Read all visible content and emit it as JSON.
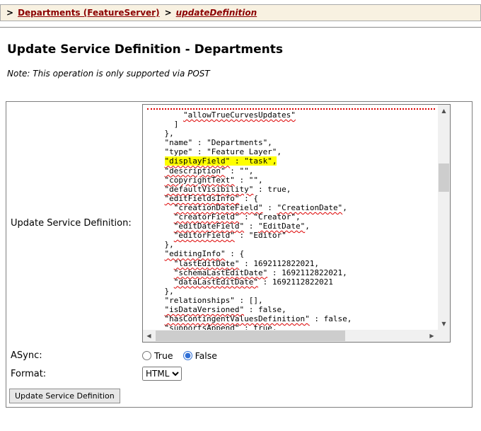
{
  "colors": {
    "breadcrumb_bg": "#f8f1e1",
    "link": "#8b0000",
    "highlight": "#ffff00",
    "spellcheck_underline": "#dd0000"
  },
  "icons": {
    "scroll_up": "▲",
    "scroll_down": "▼",
    "scroll_left": "◀",
    "scroll_right": "▶"
  },
  "breadcrumb": {
    "separator": ">",
    "items": [
      {
        "label": "Departments (FeatureServer)",
        "italic": false
      },
      {
        "label": "updateDefinition",
        "italic": true
      }
    ]
  },
  "page": {
    "title": "Update Service Definition - Departments",
    "note": "Note: This operation is only supported via POST"
  },
  "form": {
    "definition_label": "Update Service Definition:",
    "async_label": "ASync:",
    "async_options": [
      {
        "label": "True",
        "selected": false
      },
      {
        "label": "False",
        "selected": true
      }
    ],
    "format_label": "Format:",
    "format_options": [
      "HTML"
    ],
    "format_value": "HTML",
    "submit_label": "Update Service Definition"
  },
  "editor": {
    "lines": [
      {
        "partial": true,
        "segs": []
      },
      {
        "segs": [
          {
            "t": "        "
          },
          {
            "t": "\"allowTrueCurvesUpdates\"",
            "u": true
          }
        ]
      },
      {
        "segs": [
          {
            "t": "      ]"
          }
        ]
      },
      {
        "segs": [
          {
            "t": "    },"
          }
        ]
      },
      {
        "segs": [
          {
            "t": "    \"name\" : \"Departments\","
          }
        ]
      },
      {
        "segs": [
          {
            "t": "    \"type\" : \"Feature Layer\","
          }
        ]
      },
      {
        "segs": [
          {
            "t": "    "
          },
          {
            "t": "\"displayField\"",
            "u": true,
            "hl": true
          },
          {
            "t": " : \"task\",",
            "hl": true
          }
        ]
      },
      {
        "segs": [
          {
            "t": "    "
          },
          {
            "t": "\"description\"",
            "u": true
          },
          {
            "t": " : \"\","
          }
        ]
      },
      {
        "segs": [
          {
            "t": "    "
          },
          {
            "t": "\"copyrightText\"",
            "u": true
          },
          {
            "t": " : \"\","
          }
        ]
      },
      {
        "segs": [
          {
            "t": "    "
          },
          {
            "t": "\"defaultVisibility\"",
            "u": true
          },
          {
            "t": " : true,"
          }
        ]
      },
      {
        "segs": [
          {
            "t": "    "
          },
          {
            "t": "\"editFieldsInfo\"",
            "u": true
          },
          {
            "t": " : {"
          }
        ]
      },
      {
        "segs": [
          {
            "t": "      "
          },
          {
            "t": "\"creationDateField\"",
            "u": true
          },
          {
            "t": " : "
          },
          {
            "t": "\"CreationDate\"",
            "u": true
          },
          {
            "t": ","
          }
        ]
      },
      {
        "segs": [
          {
            "t": "      "
          },
          {
            "t": "\"creatorField\"",
            "u": true
          },
          {
            "t": " : \"Creator\","
          }
        ]
      },
      {
        "segs": [
          {
            "t": "      "
          },
          {
            "t": "\"editDateField\"",
            "u": true
          },
          {
            "t": " : "
          },
          {
            "t": "\"EditDate\"",
            "u": true
          },
          {
            "t": ","
          }
        ]
      },
      {
        "segs": [
          {
            "t": "      "
          },
          {
            "t": "\"editorField\"",
            "u": true
          },
          {
            "t": " : \"Editor\""
          }
        ]
      },
      {
        "segs": [
          {
            "t": "    },"
          }
        ]
      },
      {
        "segs": [
          {
            "t": "    "
          },
          {
            "t": "\"editingInfo\"",
            "u": true
          },
          {
            "t": " : {"
          }
        ]
      },
      {
        "segs": [
          {
            "t": "      "
          },
          {
            "t": "\"lastEditDate\"",
            "u": true
          },
          {
            "t": " : 1692112822021,"
          }
        ]
      },
      {
        "segs": [
          {
            "t": "      "
          },
          {
            "t": "\"schemaLastEditDate\"",
            "u": true
          },
          {
            "t": " : 1692112822021,"
          }
        ]
      },
      {
        "segs": [
          {
            "t": "      "
          },
          {
            "t": "\"dataLastEditDate\"",
            "u": true
          },
          {
            "t": " : 1692112822021"
          }
        ]
      },
      {
        "segs": [
          {
            "t": "    },"
          }
        ]
      },
      {
        "segs": [
          {
            "t": "    \"relationships\" : [],"
          }
        ]
      },
      {
        "segs": [
          {
            "t": "    "
          },
          {
            "t": "\"isDataVersioned\"",
            "u": true
          },
          {
            "t": " : false,"
          }
        ]
      },
      {
        "segs": [
          {
            "t": "    "
          },
          {
            "t": "\"hasContingentValuesDefinition\"",
            "u": true
          },
          {
            "t": " : false,"
          }
        ]
      },
      {
        "segs": [
          {
            "t": "    "
          },
          {
            "t": "\"supportsAppend\"",
            "u": true
          },
          {
            "t": " : true,"
          }
        ]
      }
    ]
  }
}
